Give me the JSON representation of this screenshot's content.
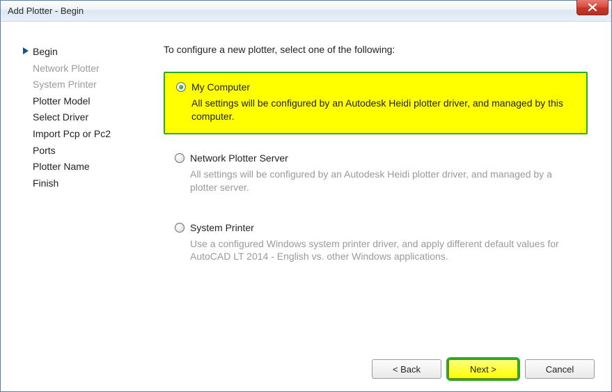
{
  "window": {
    "title": "Add Plotter - Begin"
  },
  "sidebar": {
    "steps": [
      {
        "label": "Begin",
        "state": "current"
      },
      {
        "label": "Network Plotter",
        "state": "disabled"
      },
      {
        "label": "System Printer",
        "state": "disabled"
      },
      {
        "label": "Plotter Model",
        "state": "normal"
      },
      {
        "label": "Select Driver",
        "state": "normal"
      },
      {
        "label": "Import Pcp or Pc2",
        "state": "normal"
      },
      {
        "label": "Ports",
        "state": "normal"
      },
      {
        "label": "Plotter Name",
        "state": "normal"
      },
      {
        "label": "Finish",
        "state": "normal"
      }
    ]
  },
  "main": {
    "instruction": "To configure a new plotter, select one of the following:",
    "options": [
      {
        "label": "My Computer",
        "description": "All settings will be configured by an Autodesk Heidi plotter driver, and managed by this computer.",
        "selected": true,
        "highlighted": true
      },
      {
        "label": "Network Plotter Server",
        "description": "All settings will be configured by an Autodesk Heidi plotter driver, and managed by a plotter server.",
        "selected": false,
        "highlighted": false
      },
      {
        "label": "System Printer",
        "description": "Use a configured Windows system printer driver, and apply different default values for AutoCAD LT 2014 - English vs. other Windows applications.",
        "selected": false,
        "highlighted": false
      }
    ]
  },
  "buttons": {
    "back": "< Back",
    "next": "Next >",
    "cancel": "Cancel"
  }
}
